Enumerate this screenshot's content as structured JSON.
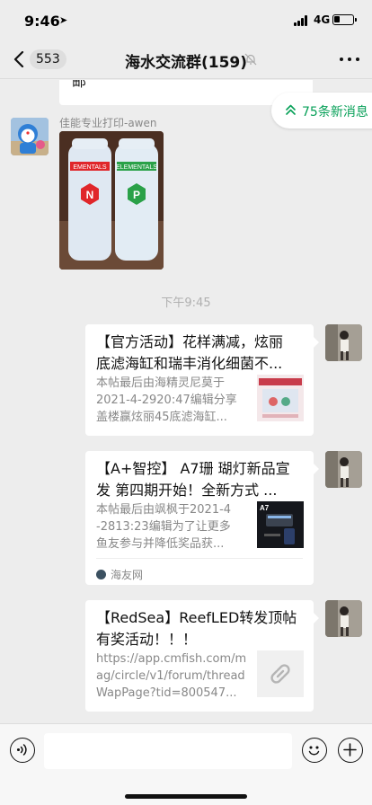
{
  "status": {
    "time": "9:46",
    "network": "4G",
    "battery_level": 0.3
  },
  "nav": {
    "unread_count": "553",
    "title": "海水交流群(159)"
  },
  "chat": {
    "partial_text": "邮",
    "new_messages_label": "75条新消息",
    "sender_name": "佳能专业打印-awen",
    "photo_labels": [
      "EMENTALS",
      "ELEMENTALS"
    ],
    "photo_bottle_letters": [
      "N",
      "P"
    ],
    "time_divider": "下午9:45",
    "cards": [
      {
        "title": "【官方活动】花样满减，炫丽\n底滤海缸和瑞丰消化细菌不...",
        "desc": "本帖最后由海精灵尼莫于\n2021-4-2920:47编辑分享\n盖楼赢炫丽45底滤海缸..."
      },
      {
        "title": "【A+智控】 A7珊 瑚灯新品宣\n发 第四期开始！全新方式 ...",
        "desc": "本帖最后由飒枫于2021-4\n-2813:23编辑为了让更多\n鱼友参与并降低奖品获...",
        "thumb_text": "A7",
        "source": "海友网"
      },
      {
        "title": "【RedSea】ReefLED转发顶帖\n有奖活动！！！",
        "desc": "https://app.cmfish.com/m\nag/circle/v1/forum/thread\nWapPage?tid=800547..."
      }
    ]
  },
  "input": {
    "placeholder": ""
  },
  "colors": {
    "accent_green": "#07a058",
    "background": "#ededed"
  }
}
